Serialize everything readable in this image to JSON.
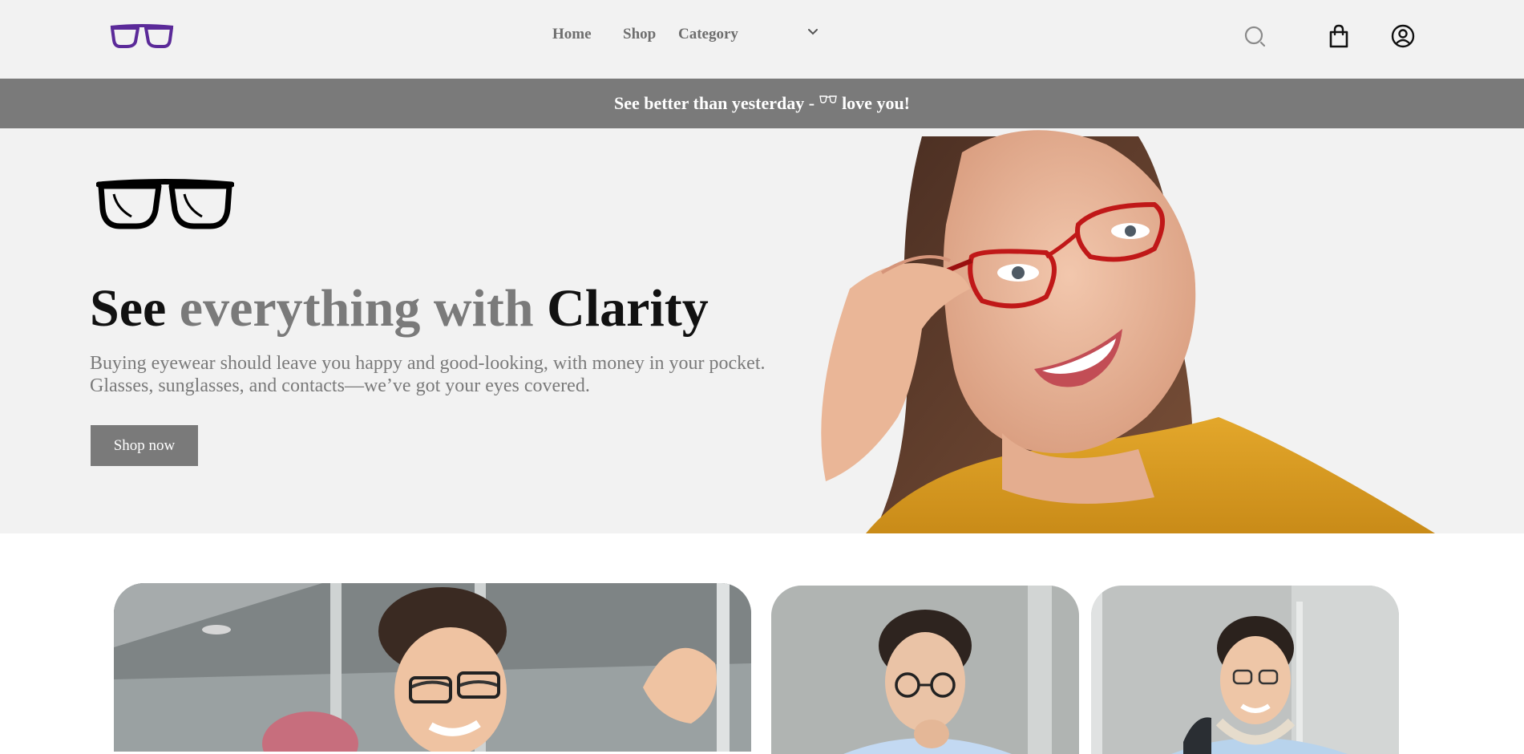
{
  "header": {
    "logo_icon": "eyeglasses-logo-icon",
    "brand_color": "#5b2a99",
    "nav": {
      "home": "Home",
      "shop": "Shop",
      "category": "Category"
    },
    "icons": [
      "search-icon",
      "shopping-bag-icon",
      "user-account-icon"
    ]
  },
  "announcement": {
    "before": "See better than yesterday -",
    "after": "love you!",
    "background": "#7a7a7a"
  },
  "hero": {
    "title_part1": "See",
    "title_part2": "everything with",
    "title_part3": "Clarity",
    "subtitle_line1": "Buying eyewear should leave you happy and good-looking, with money in your pocket.",
    "subtitle_line2": "Glasses, sunglasses, and contacts—we’ve got your eyes covered.",
    "cta": "Shop now",
    "image": "woman-with-red-glasses-photo",
    "accent_color": "#7a7a7a"
  },
  "gallery": {
    "images": [
      "couple-with-glasses-photo",
      "man-with-round-glasses-photo",
      "man-with-headphones-photo"
    ]
  }
}
